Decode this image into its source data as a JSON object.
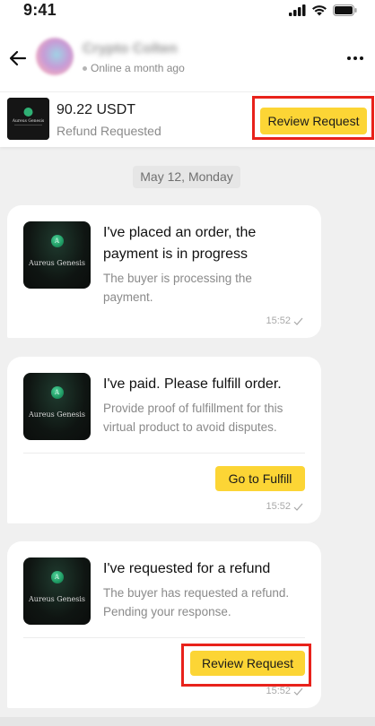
{
  "status_bar": {
    "time": "9:41"
  },
  "header": {
    "contact_name": "Crypto Colten",
    "presence": "Online a month ago",
    "icons": [
      "back-arrow-icon",
      "more-options-icon"
    ]
  },
  "order": {
    "amount": "90.22 USDT",
    "status": "Refund Requested",
    "review_label": "Review Request",
    "product_brand": "Aureus Genesis"
  },
  "chat": {
    "date_label": "May 12, Monday",
    "messages": [
      {
        "title_line1": "I've placed an order, the",
        "title_line2": "payment is in progress",
        "body_line1": "The buyer is processing the",
        "body_line2": "payment.",
        "time": "15:52"
      },
      {
        "title_line1": "I've paid. Please fulfill order.",
        "body_line1": "Provide proof of fulfillment for this",
        "body_line2": "virtual product to avoid disputes.",
        "action_label": "Go to Fulfill",
        "time": "15:52"
      },
      {
        "title_line1": "I've requested for a refund",
        "body_line1": "The buyer has requested a refund.",
        "body_line2": "Pending your response.",
        "action_label": "Review Request",
        "time": "15:52"
      }
    ]
  },
  "colors": {
    "accent_yellow": "#fcd535",
    "highlight_red": "#e8221b",
    "background": "#f0f0f0"
  }
}
